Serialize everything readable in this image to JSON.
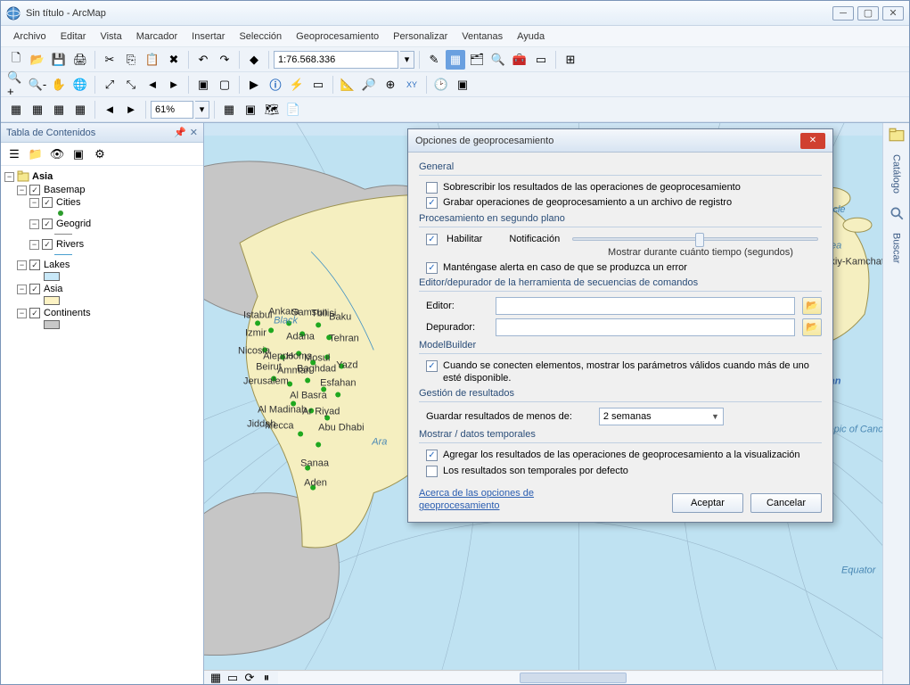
{
  "window": {
    "title": "Sin título - ArcMap"
  },
  "menu": [
    "Archivo",
    "Editar",
    "Vista",
    "Marcador",
    "Insertar",
    "Selección",
    "Geoprocesamiento",
    "Personalizar",
    "Ventanas",
    "Ayuda"
  ],
  "toolbar": {
    "scale": "1:76.568.336",
    "zoom": "61%"
  },
  "toc": {
    "title": "Tabla de Contenidos",
    "root": "Asia",
    "layers": [
      {
        "name": "Basemap"
      },
      {
        "name": "Cities"
      },
      {
        "name": "Geogrid"
      },
      {
        "name": "Rivers"
      },
      {
        "name": "Lakes"
      },
      {
        "name": "Asia"
      },
      {
        "name": "Continents"
      }
    ]
  },
  "rail": {
    "catalog": "Catálogo",
    "search": "Buscar"
  },
  "map_labels": {
    "ocean": "Ocean",
    "arctic": "Arctic Circle",
    "bering": "Bering Sea",
    "tropic": "Tropic of Cancer",
    "equator": "Equator",
    "kam": "skiy-Kamchatskiy",
    "ara": "Ara",
    "cities": [
      "Istabul",
      "Ankara",
      "Samsun",
      "Tbilisi",
      "Baku",
      "Izmir",
      "Adana",
      "Tehran",
      "Nicosia",
      "Aleppo",
      "Homs",
      "Mosul",
      "Beirut",
      "Amman",
      "Baghdad",
      "Yazd",
      "Jerusalem",
      "Esfahan",
      "Al Basra",
      "Al Madinah",
      "Ar Riyad",
      "Jiddah",
      "Mecca",
      "Abu Dhabi",
      "Sanaa",
      "Aden",
      "Black"
    ]
  },
  "dialog": {
    "title": "Opciones de geoprocesamiento",
    "sections": {
      "general": "General",
      "general_opt1": "Sobrescribir los resultados de las operaciones de geoprocesamiento",
      "general_opt2": "Grabar operaciones de geoprocesamiento a un archivo de registro",
      "background": "Procesamiento en segundo plano",
      "enable": "Habilitar",
      "notification": "Notificación",
      "show_time": "Mostrar durante cuánto tiempo (segundos)",
      "stay_alert": "Manténgase alerta en caso de que se produzca un error",
      "editor_section": "Editor/depurador de la herramienta de secuencias de comandos",
      "editor": "Editor:",
      "debugger": "Depurador:",
      "modelbuilder": "ModelBuilder",
      "mb_opt": "Cuando se conecten elementos, mostrar los parámetros válidos cuando más de uno esté disponible.",
      "results": "Gestión de resultados",
      "keep_results": "Guardar resultados de menos de:",
      "keep_value": "2 semanas",
      "display": "Mostrar / datos temporales",
      "display_opt1": "Agregar los resultados de las operaciones de geoprocesamiento a la visualización",
      "display_opt2": "Los resultados son temporales por defecto",
      "about": "Acerca de las opciones de geoprocesamiento",
      "ok": "Aceptar",
      "cancel": "Cancelar"
    }
  }
}
